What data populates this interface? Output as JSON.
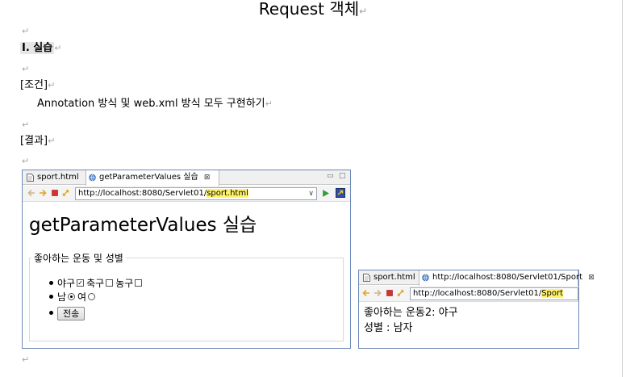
{
  "document": {
    "title": "Request  객체",
    "para_mark": "↵",
    "section_heading": "I.  실습",
    "condition_label": "[조건]",
    "condition_text": "Annotation  방식  및  web.xml  방식  모두  구현하기",
    "result_label": "[결과]"
  },
  "browser1": {
    "tabs": [
      {
        "label": "sport.html"
      },
      {
        "label": "getParameterValues 실습",
        "close": "⊠"
      }
    ],
    "window_controls": {
      "minimize": "▭",
      "maximize": "□"
    },
    "url_prefix": "http://localhost:8080/Servlet01/",
    "url_highlight": "sport.html",
    "url_dropdown": "∨",
    "page": {
      "heading": "getParameterValues 실습",
      "legend": "좋아하는 운동 및 성별",
      "sports": [
        {
          "label": "야구",
          "checked": true
        },
        {
          "label": "축구",
          "checked": false
        },
        {
          "label": "농구",
          "checked": false
        }
      ],
      "genders": [
        {
          "label": "남",
          "selected": true
        },
        {
          "label": "여",
          "selected": false
        }
      ],
      "submit_label": "전송"
    }
  },
  "browser2": {
    "tabs": [
      {
        "label": "sport.html"
      },
      {
        "label": "http://localhost:8080/Servlet01/Sport",
        "close": "⊠"
      }
    ],
    "url_prefix": "http://localhost:8080/Servlet01/",
    "url_highlight": "Sport",
    "page": {
      "line1": "좋아하는 운동2: 야구",
      "line2": "성별 : 남자"
    }
  },
  "colors": {
    "window_border": "#6d89b8",
    "url_highlight": "#fff36b",
    "heading_highlight": "#e6e6e6"
  },
  "icons": [
    "file-icon",
    "globe-icon",
    "back-arrow-icon",
    "forward-arrow-icon",
    "stop-icon",
    "refresh-icon",
    "go-icon",
    "external-browser-icon"
  ]
}
